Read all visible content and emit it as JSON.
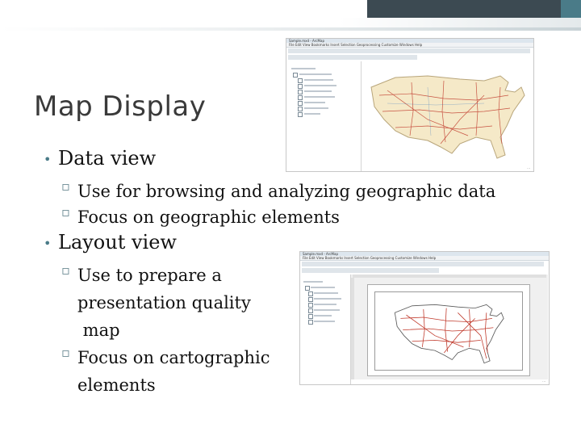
{
  "slide": {
    "title": "Map Display",
    "items": [
      {
        "label": "Data view",
        "subitems": [
          "Use for browsing and analyzing geographic data",
          "Focus on geographic elements"
        ]
      },
      {
        "label": "Layout view",
        "subitems": [
          "Use to prepare a\npresentation quality\n map",
          "Focus on cartographic\nelements"
        ]
      }
    ]
  },
  "screens": {
    "data_view": {
      "window_title": "Sample.mxd - ArcMap",
      "menu": "File  Edit  View  Bookmarks  Insert  Selection  Geoprocessing  Customize  Windows  Help"
    },
    "layout_view": {
      "window_title": "Sample.mxd - ArcMap",
      "menu": "File  Edit  View  Bookmarks  Insert  Selection  Geoprocessing  Customize  Windows  Help"
    }
  },
  "colors": {
    "accent": "#4a7b88",
    "topbar_dark": "#3c4a52",
    "map_land": "#f5e9c8",
    "map_roads": "#c0392b"
  },
  "icons": [
    "bullet-dot-icon",
    "square-bullet-icon",
    "us-map-icon"
  ]
}
